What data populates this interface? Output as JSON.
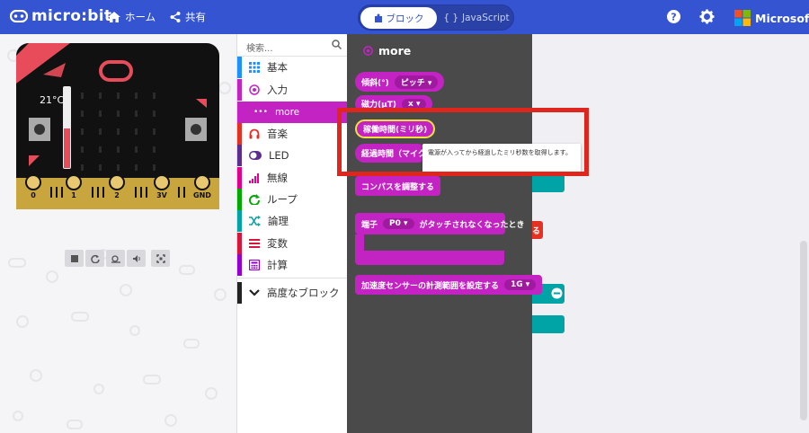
{
  "header": {
    "app_name": "micro:bit",
    "home_label": "ホーム",
    "share_label": "共有",
    "tab_blocks": "ブロック",
    "tab_js": "JavaScript",
    "ms_label": "Microsoft"
  },
  "simulator": {
    "temperature": "21°C",
    "pins": [
      "0",
      "1",
      "2",
      "3V",
      "GND"
    ]
  },
  "toolbox": {
    "search_placeholder": "検索...",
    "categories": [
      {
        "label": "基本",
        "color": "#1e90ff"
      },
      {
        "label": "入力",
        "color": "#c423c4"
      },
      {
        "label": "more",
        "color": "#c423c4"
      },
      {
        "label": "音楽",
        "color": "#e63022"
      },
      {
        "label": "LED",
        "color": "#5c2d91"
      },
      {
        "label": "無線",
        "color": "#e3008c"
      },
      {
        "label": "ループ",
        "color": "#00aa00"
      },
      {
        "label": "論理",
        "color": "#00a4a6"
      },
      {
        "label": "変数",
        "color": "#dc143c"
      },
      {
        "label": "計算",
        "color": "#9400d3"
      },
      {
        "label": "高度なブロック",
        "color": "#222222"
      }
    ]
  },
  "flyout": {
    "title": "more",
    "blocks": {
      "tilt_label": "傾斜(°)",
      "tilt_option": "ピッチ",
      "magnetic_label": "磁力(µT)",
      "magnetic_option": "x",
      "running_time": "稼働時間(ミリ秒)",
      "elapsed_time": "経過時間（マイク",
      "calibrate": "コンパスを調整する",
      "pin_prefix": "端子",
      "pin_option": "P0",
      "pin_suffix": "がタッチされなくなったとき",
      "accel_range": "加速度センサーの計測範囲を設定する",
      "accel_option": "1G"
    },
    "tooltip": "電源が入ってから経過したミリ秒数を取得します。"
  },
  "workspace": {
    "partial_text": "る"
  },
  "colors": {
    "header": "#3454d1",
    "input_block": "#c423c4",
    "highlight": "#e0251c"
  }
}
